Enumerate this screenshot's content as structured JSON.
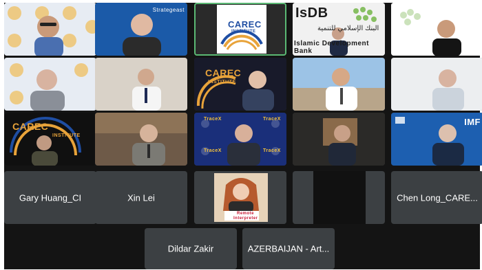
{
  "row1": [
    {
      "id": "r1c1"
    },
    {
      "id": "r1c2",
      "overlay_text": "Strategeast"
    },
    {
      "id": "r1c3",
      "logo_main": "CAREC",
      "logo_sub": "INSTITUTE"
    },
    {
      "id": "r1c4",
      "logo_main": "IsDB",
      "logo_arabic": "البنك الإسلامي للتنمية",
      "logo_en": "Islamic Development Bank"
    },
    {
      "id": "r1c5"
    }
  ],
  "row2": [
    {
      "id": "r2c1"
    },
    {
      "id": "r2c2"
    },
    {
      "id": "r2c3",
      "logo_main": "CAREC",
      "logo_sub": "INSTITUTE"
    },
    {
      "id": "r2c4"
    },
    {
      "id": "r2c5"
    }
  ],
  "row3": [
    {
      "id": "r3c1",
      "logo_main": "CAREC",
      "logo_sub": "INSTITUTE"
    },
    {
      "id": "r3c2"
    },
    {
      "id": "r3c3",
      "backdrop_text": "TraceX"
    },
    {
      "id": "r3c4"
    },
    {
      "id": "r3c5",
      "logo_main": "IMF"
    }
  ],
  "row4": [
    {
      "id": "r4c1",
      "name": "Gary Huang_CI"
    },
    {
      "id": "r4c2",
      "name": "Xin Lei"
    },
    {
      "id": "r4c3",
      "badge_line1": "Remote",
      "badge_line2": "Interpreter"
    },
    {
      "id": "r4c4"
    },
    {
      "id": "r4c5",
      "name": "Chen Long_CARE..."
    }
  ],
  "row5": [
    {
      "id": "r5c1",
      "name": "Dildar Zakir"
    },
    {
      "id": "r5c2",
      "name": "AZERBAIJAN - Art..."
    }
  ],
  "colors": {
    "stage": "#141414",
    "tile": "#3c4043",
    "active_border": "#5bb974",
    "carec_orange": "#e8a33a",
    "carec_blue": "#1f4ea3"
  }
}
